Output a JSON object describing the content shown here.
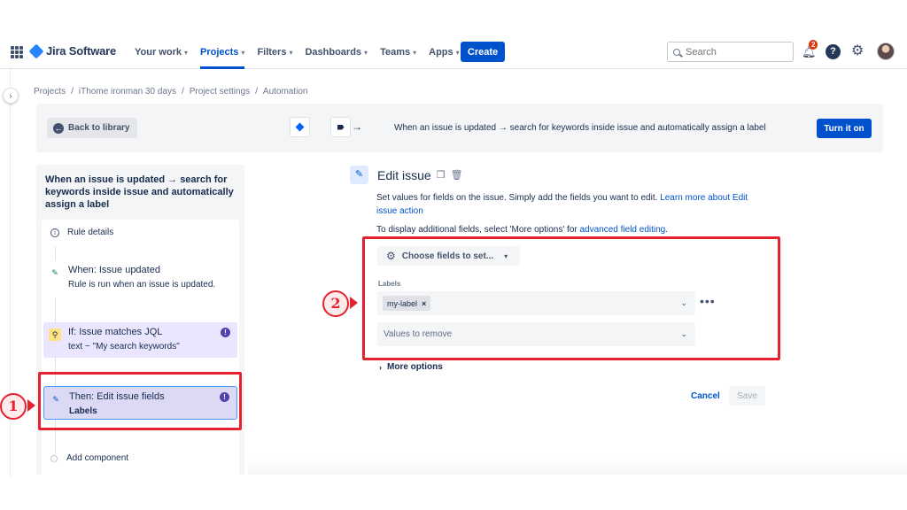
{
  "topnav": {
    "brand": "Jira Software",
    "items": [
      {
        "label": "Your work"
      },
      {
        "label": "Projects"
      },
      {
        "label": "Filters"
      },
      {
        "label": "Dashboards"
      },
      {
        "label": "Teams"
      },
      {
        "label": "Apps"
      }
    ],
    "active_item": "Projects",
    "create_label": "Create",
    "search_placeholder": "Search",
    "notification_count": "2",
    "help_glyph": "?"
  },
  "breadcrumb": [
    "Projects",
    "iThome ironman 30 days",
    "Project settings",
    "Automation"
  ],
  "banner": {
    "back_label": "Back to library",
    "rule_summary": "When an issue is updated → search for keywords inside issue and automatically assign a label",
    "turn_on_label": "Turn it on"
  },
  "rule": {
    "title": "When an issue is updated → search for keywords inside issue and automatically assign a label",
    "details_label": "Rule details",
    "steps": [
      {
        "title": "When: Issue updated",
        "subtitle": "Rule is run when an issue is updated."
      },
      {
        "title": "If: Issue matches JQL",
        "subtitle": "text ~ \"My search keywords\""
      },
      {
        "title": "Then: Edit issue fields",
        "subtitle": "Labels"
      }
    ],
    "add_component_label": "Add component"
  },
  "edit": {
    "title": "Edit issue",
    "description": "Set values for fields on the issue. Simply add the fields you want to edit. ",
    "description_link": "Learn more about Edit issue action",
    "more_info": "To display additional fields, select 'More options' for ",
    "more_info_link": "advanced field editing",
    "more_info_end": ".",
    "choose_fields_label": "Choose fields to set...",
    "labels_field_label": "Labels",
    "selected_label": "my-label",
    "values_to_remove_placeholder": "Values to remove",
    "more_options_label": "More options",
    "cancel_label": "Cancel",
    "save_label": "Save"
  },
  "annotations": {
    "marker1": "1",
    "marker2": "2"
  },
  "colors": {
    "brand_blue": "#0052cc",
    "highlight_red": "#e5222f",
    "jql_step_bg": "#eae6ff",
    "badge_purple": "#5243aa"
  },
  "icons": {
    "apps": "grid-icon",
    "notifications": "bell-icon",
    "help": "help-icon",
    "settings": "gear-icon",
    "back": "arrow-left-icon",
    "edit": "pencil-icon",
    "copy": "copy-icon",
    "delete": "trash-icon"
  }
}
